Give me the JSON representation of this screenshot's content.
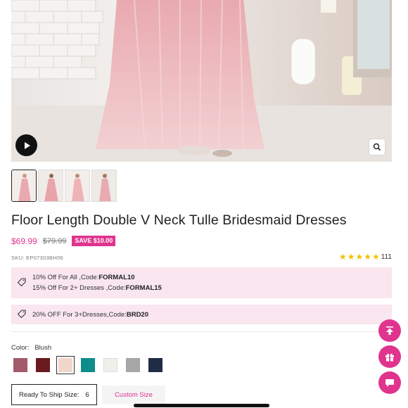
{
  "product": {
    "title": "Floor Length Double V Neck Tulle Bridesmaid Dresses",
    "price": "$69.99",
    "old_price": "$79.99",
    "save_badge": "SAVE $10.00",
    "sku": "SKU: EP07303BH06",
    "rating": 5,
    "review_count": "111"
  },
  "gallery": {
    "thumbnail_count": 4,
    "active_index": 0
  },
  "promos": [
    {
      "line1_prefix": "10% Off For All ,Code:",
      "line1_code": "FORMAL10",
      "line2_prefix": "15% Off For 2+ Dresses ,Code:",
      "line2_code": "FORMAL15"
    },
    {
      "line1_prefix": "20% OFF For 3+Dresses,Code:",
      "line1_code": "BRD20"
    }
  ],
  "color": {
    "label": "Color:",
    "selected": "Blush",
    "swatches": [
      "#a35a6a",
      "#6b1a1f",
      "#f1d6cc",
      "#0d8d8a",
      "#eef0ea",
      "#a6a6a6",
      "#1f2c45"
    ],
    "selected_index": 3
  },
  "size": {
    "label": "Ready To Ship Size:",
    "value": "6",
    "custom_label": "Custom Size"
  },
  "icons": {
    "play": "play-icon",
    "zoom": "zoom-icon",
    "tag": "tag-icon",
    "back_to_top": "arrow-up-icon",
    "gift": "gift-icon",
    "chat": "chat-icon"
  },
  "colors": {
    "accent": "#e0348e",
    "promo_bg": "#f9e6ef",
    "star": "#f2c200"
  }
}
